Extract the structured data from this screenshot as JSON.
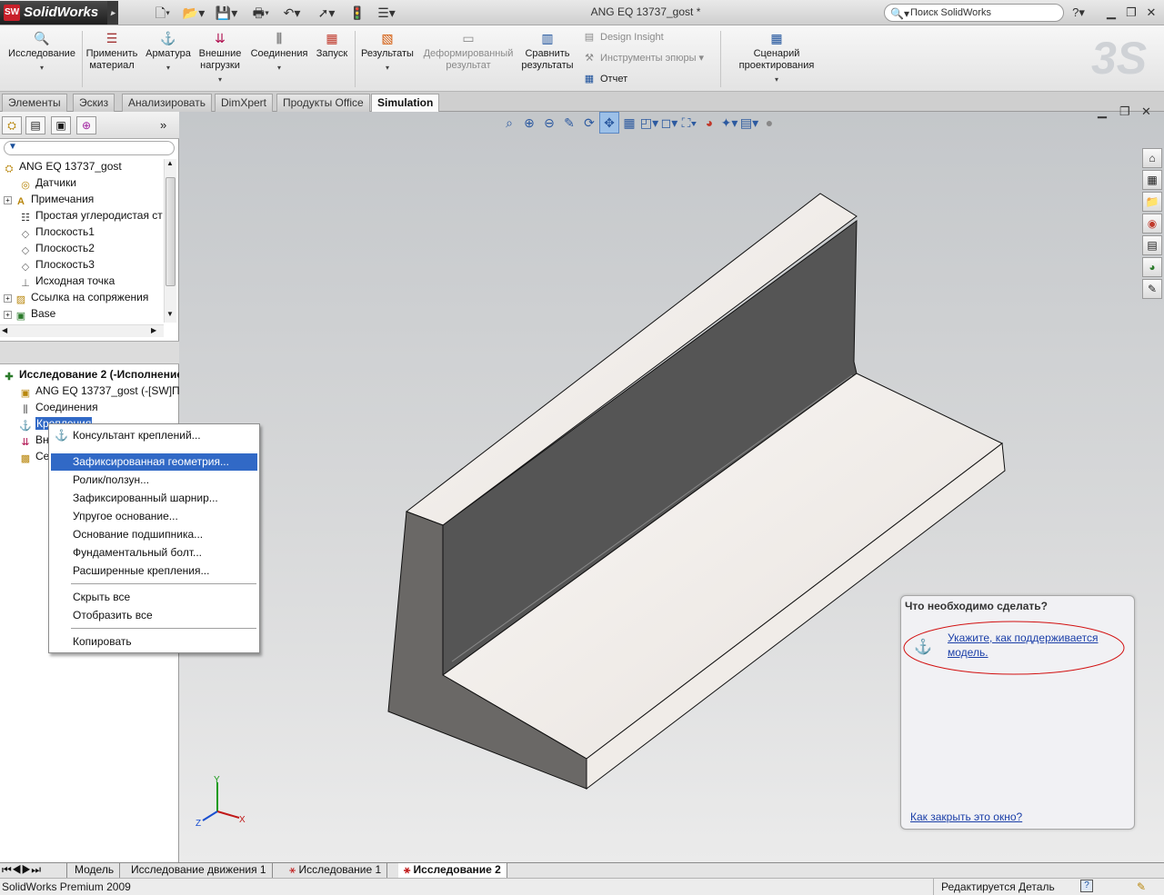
{
  "app": {
    "logo_text": "SolidWorks",
    "document_title": "ANG EQ 13737_gost *",
    "search_placeholder": "Поиск SolidWorks"
  },
  "ribbon": {
    "buttons": [
      {
        "label": "Исследование",
        "icon": "study-icon"
      },
      {
        "label": "Применить материал",
        "icon": "material-icon"
      },
      {
        "label": "Арматура",
        "icon": "fixture-icon"
      },
      {
        "label": "Внешние нагрузки",
        "icon": "loads-icon"
      },
      {
        "label": "Соединения",
        "icon": "connections-icon"
      },
      {
        "label": "Запуск",
        "icon": "run-icon"
      },
      {
        "label": "Результаты",
        "icon": "results-icon"
      },
      {
        "label": "Деформированный результат",
        "icon": "deformed-icon"
      },
      {
        "label": "Сравнить результаты",
        "icon": "compare-icon"
      },
      {
        "label": "Сценарий проектирования",
        "icon": "scenario-icon"
      }
    ],
    "small": [
      {
        "label": "Design Insight"
      },
      {
        "label": "Инструменты эпюры"
      },
      {
        "label": "Отчет"
      }
    ]
  },
  "cmd_tabs": [
    "Элементы",
    "Эскиз",
    "Анализировать",
    "DimXpert",
    "Продукты Office",
    "Simulation"
  ],
  "tree": {
    "root": "ANG EQ 13737_gost",
    "items": [
      "Датчики",
      "Примечания",
      "Простая углеродистая ст",
      "Плоскость1",
      "Плоскость2",
      "Плоскость3",
      "Исходная точка",
      "Ссылка на сопряжения",
      "Base"
    ]
  },
  "study_tree": {
    "root": "Исследование 2 (-Исполнение",
    "items": [
      "ANG EQ 13737_gost (-[SW]Пр",
      "Соединения",
      "Крепления",
      "Вн",
      "Се"
    ]
  },
  "context_menu": {
    "items": [
      "Консультант креплений...",
      "Зафиксированная геометрия...",
      "Ролик/ползун...",
      "Зафиксированный шарнир...",
      "Упругое основание...",
      "Основание подшипника...",
      "Фундаментальный болт...",
      "Расширенные крепления...",
      "Скрыть все",
      "Отобразить все",
      "Копировать"
    ],
    "highlighted": 1
  },
  "what_to_do": {
    "title": "Что необходимо сделать?",
    "link": "Укажите, как поддерживается модель.",
    "close_link": "Как закрыть это окно?"
  },
  "bottom_tabs": [
    "Модель",
    "Исследование движения 1",
    "Исследование 1",
    "Исследование 2"
  ],
  "status": {
    "product": "SolidWorks Premium 2009",
    "mode": "Редактируется Деталь"
  },
  "triad": {
    "x": "X",
    "y": "Y",
    "z": "Z"
  }
}
